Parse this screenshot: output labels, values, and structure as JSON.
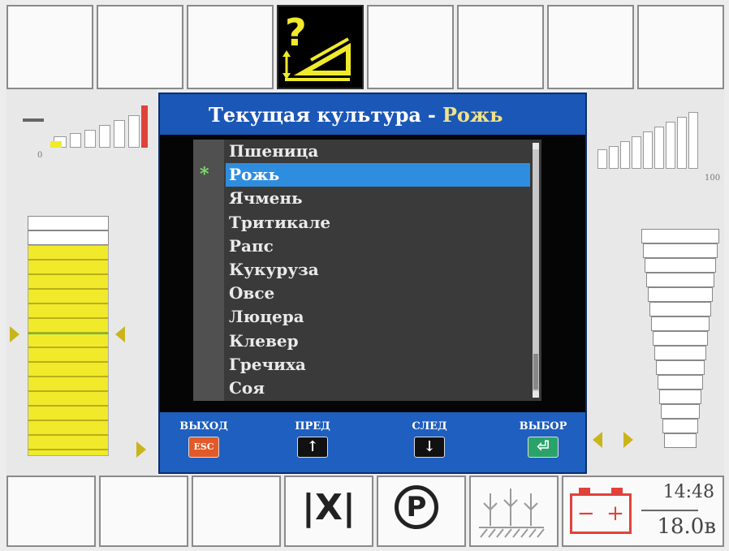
{
  "dialog": {
    "title_prefix": "Текущая культура",
    "title_sep": "-",
    "title_current": "Рожь",
    "items": [
      "Пшеница",
      "Рожь",
      "Ячмень",
      "Тритикале",
      "Рапс",
      "Кукуруза",
      "Овсе",
      "Люцера",
      "Клевер",
      "Гречиха",
      "Соя"
    ],
    "selected_index": 1,
    "current_marker": "*"
  },
  "softkeys": {
    "exit_label": "ВЫХОД",
    "exit_key": "ESC",
    "prev_label": "ПРЕД",
    "prev_icon": "↑",
    "next_label": "СЛЕД",
    "next_icon": "↓",
    "select_label": "ВЫБОР",
    "select_icon": "⏎"
  },
  "left_gauge": {
    "min_label": "0"
  },
  "right_gauge": {
    "max_label": "100"
  },
  "status": {
    "time": "14:48",
    "voltage": "18.0в",
    "battery_minus": "−",
    "battery_plus": "+"
  },
  "bottom_icons": {
    "float_symbol": "|X|",
    "parking_symbol": "P"
  },
  "colors": {
    "dialog_bg": "#1f5fbf",
    "selection": "#2f8de0",
    "accent_yellow": "#f0ea2b",
    "warning_red": "#e0423a"
  },
  "icons": [
    "question-tilt-icon",
    "float-icon",
    "parking-icon",
    "crop-field-icon",
    "battery-icon"
  ]
}
